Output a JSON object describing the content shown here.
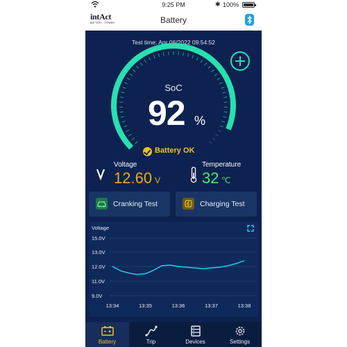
{
  "status_bar": {
    "time": "9:25 PM",
    "battery_percent": "100%"
  },
  "header": {
    "logo_word": "intAct",
    "logo_tagline": "BATTERY · POWER",
    "title": "Battery"
  },
  "test_time": "Test time: Apr 06/2022 09:54:52",
  "gauge": {
    "label": "SoC",
    "value": "92",
    "unit": "%",
    "fill_fraction": 0.92
  },
  "status_ok": "Battery OK",
  "voltage": {
    "label": "Voltage",
    "value": "12.60",
    "unit": "V"
  },
  "temperature": {
    "label": "Temperature",
    "value": "32",
    "unit": "℃"
  },
  "buttons": {
    "cranking": "Cranking Test",
    "charging": "Charging Test"
  },
  "chart_data": {
    "type": "line",
    "title": "Voltage",
    "x": [
      "13:34",
      "13:35",
      "13:36",
      "13:37",
      "13:38"
    ],
    "x_fine": [
      0,
      0.25,
      0.5,
      0.75,
      1.0,
      1.25,
      1.5,
      1.75,
      2.0,
      2.25,
      2.5,
      2.75,
      3.0,
      3.25,
      3.5,
      3.75,
      4.0
    ],
    "values": [
      12.0,
      11.7,
      11.55,
      11.45,
      11.5,
      11.75,
      12.05,
      12.1,
      12.0,
      11.95,
      11.9,
      11.85,
      11.9,
      11.95,
      12.05,
      12.2,
      12.4
    ],
    "y_ticks": [
      "15.0V",
      "13.0V",
      "12.0V",
      "11.0V",
      "9.0V"
    ],
    "y_tick_values": [
      15.0,
      13.0,
      12.0,
      11.0,
      9.0
    ],
    "grid": true,
    "line_color": "#2bd3f2"
  },
  "tabs": [
    {
      "label": "Battery",
      "icon": "battery-icon",
      "active": true
    },
    {
      "label": "Trip",
      "icon": "trip-icon",
      "active": false
    },
    {
      "label": "Devices",
      "icon": "devices-icon",
      "active": false
    },
    {
      "label": "Settings",
      "icon": "gear-icon",
      "active": false
    }
  ],
  "colors": {
    "accent_green": "#28e0b0",
    "accent_yellow": "#f2c21b",
    "voltage_orange": "#f5a623",
    "temp_green": "#4ee87a",
    "background": "#0b1d3e"
  }
}
